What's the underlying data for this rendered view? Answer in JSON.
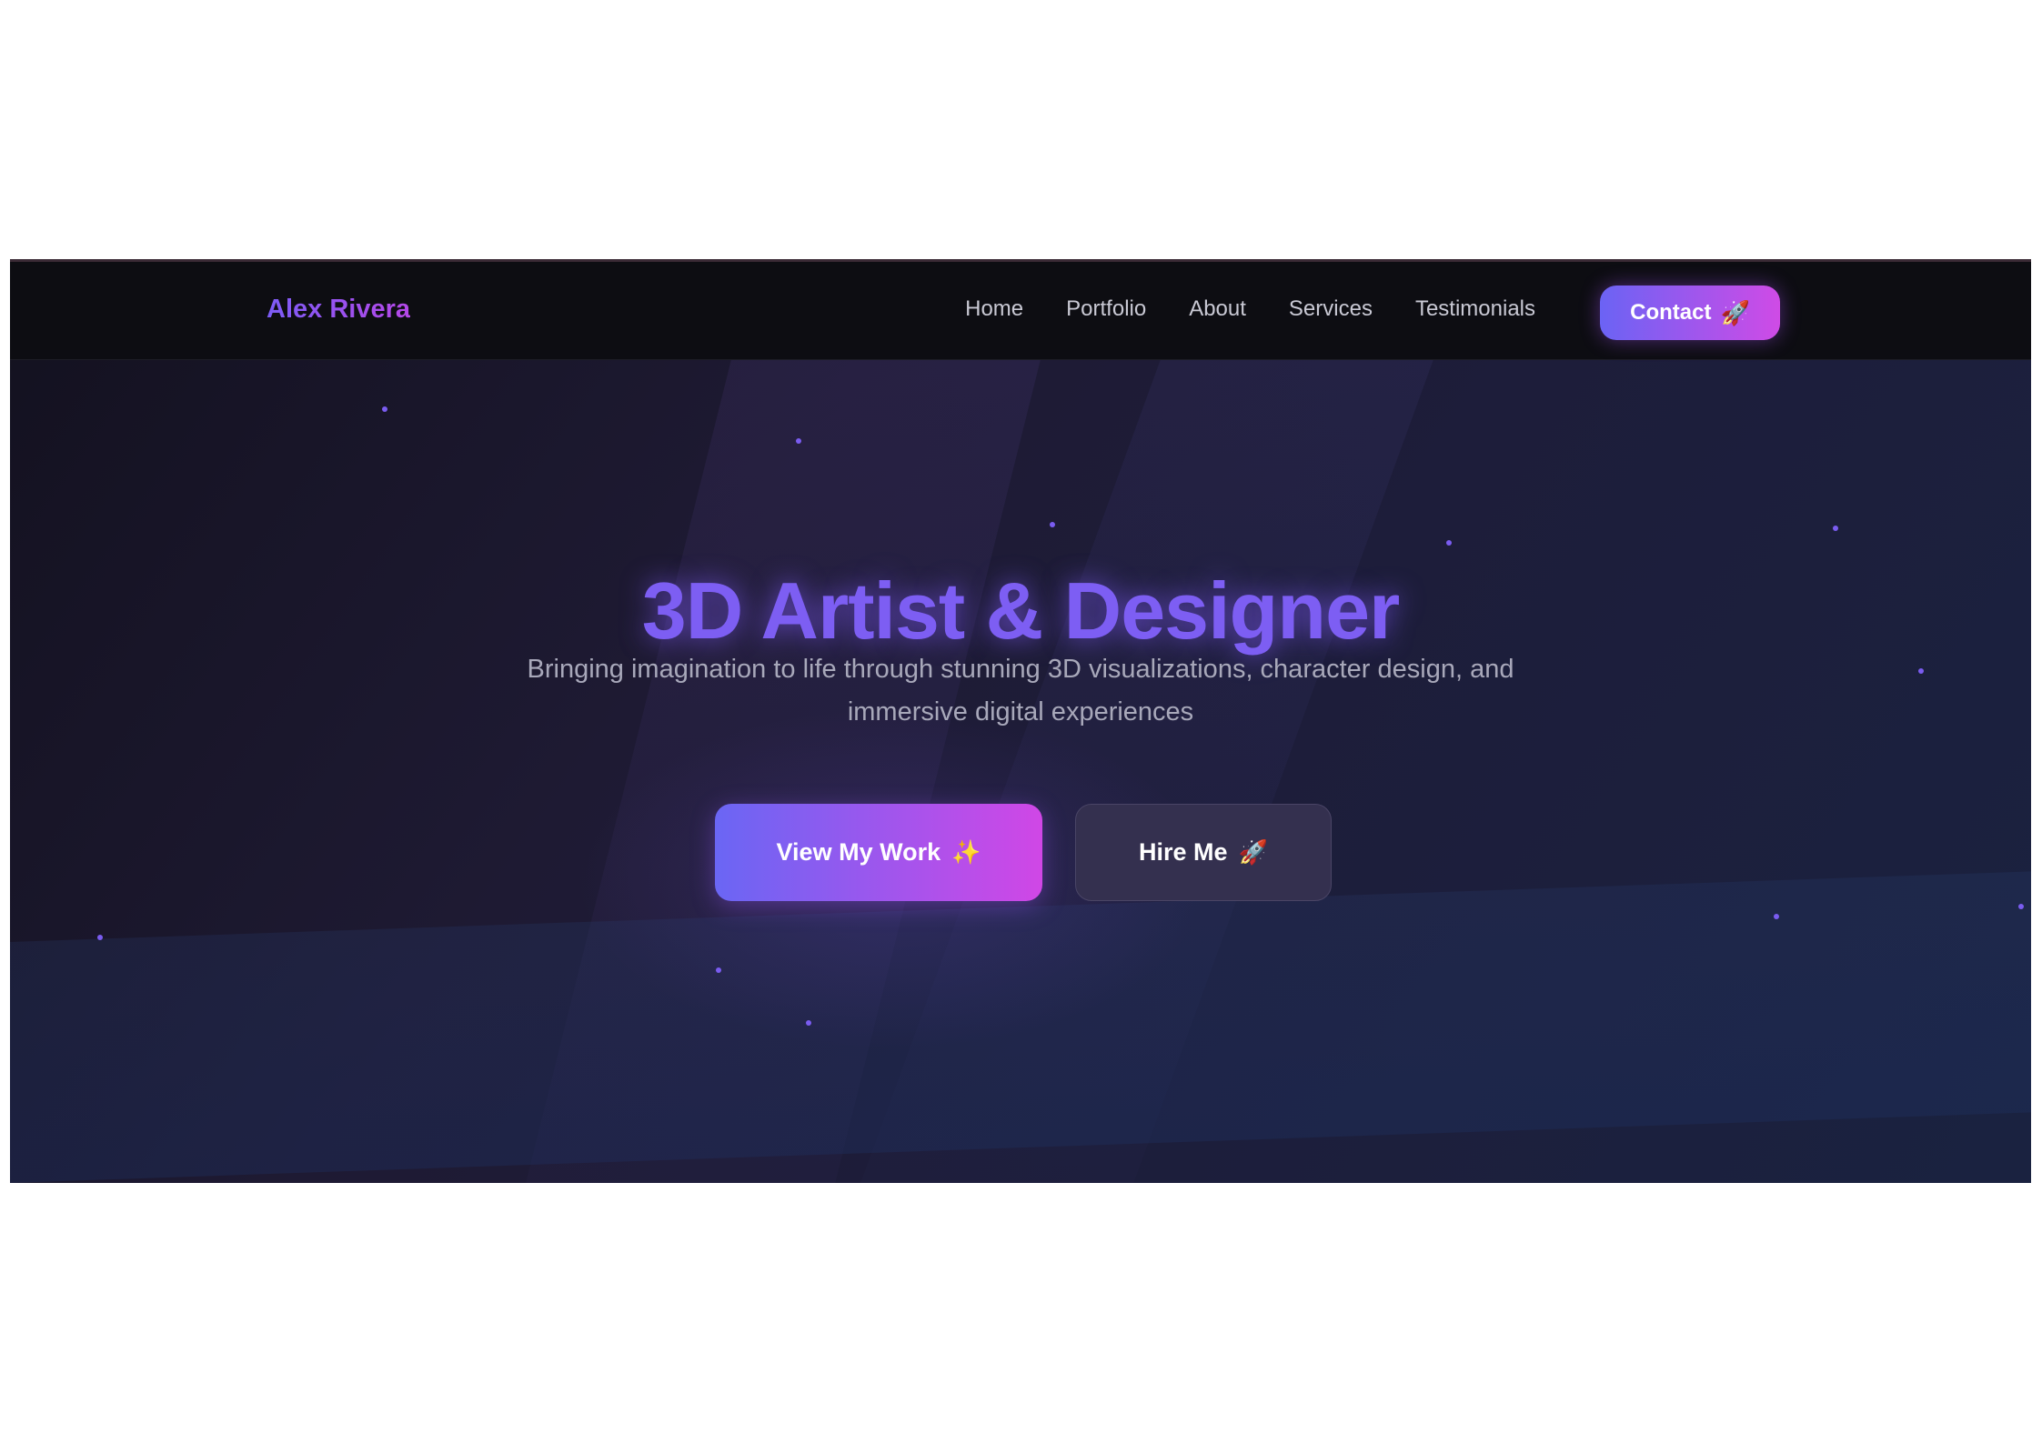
{
  "header": {
    "logo": "Alex Rivera",
    "nav": [
      "Home",
      "Portfolio",
      "About",
      "Services",
      "Testimonials"
    ],
    "contact_label": "Contact",
    "contact_icon": "🚀"
  },
  "hero": {
    "title": "3D Artist & Designer",
    "subtitle": "Bringing imagination to life through stunning 3D visualizations, character design, and immersive digital experiences",
    "primary_label": "View My Work",
    "primary_icon": "✨",
    "secondary_label": "Hire Me",
    "secondary_icon": "🚀"
  },
  "colors": {
    "accent_start": "#6a66f4",
    "accent_end": "#d047e6",
    "nav_bg": "#0d0d12",
    "hero_bg": "#1e1a33"
  }
}
